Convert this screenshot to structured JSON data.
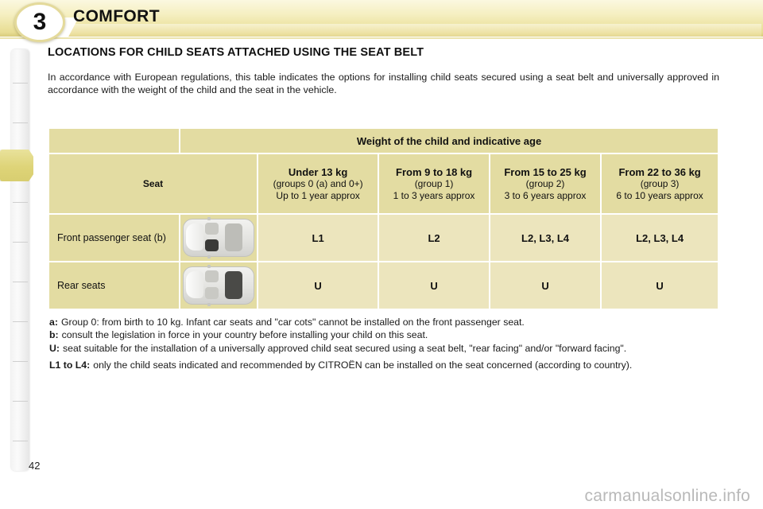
{
  "header": {
    "chapter_number": "3",
    "chapter_title": "COMFORT",
    "accent_color": "#e3dca2",
    "banner_color": "#efe8b4"
  },
  "section": {
    "title": "LOCATIONS FOR CHILD SEATS ATTACHED USING THE SEAT BELT",
    "intro": "In accordance with European regulations, this table indicates the options for installing child seats secured using a seat belt and universally approved in accordance with the weight of the child and the seat in the vehicle."
  },
  "table": {
    "band_title": "Weight of the child and indicative age",
    "seat_column_header": "Seat",
    "columns": [
      {
        "weight": "Under 13 kg",
        "group": "(groups 0 (a) and 0+)",
        "age": "Up to 1 year approx"
      },
      {
        "weight": "From 9 to 18 kg",
        "group": "(group 1)",
        "age": "1 to 3 years approx"
      },
      {
        "weight": "From 15 to 25 kg",
        "group": "(group 2)",
        "age": "3 to 6 years approx"
      },
      {
        "weight": "From 22 to 36 kg",
        "group": "(group 3)",
        "age": "6 to 10 years approx"
      }
    ],
    "rows": [
      {
        "label": "Front passenger seat (b)",
        "icon": "car-top-view-front-passenger-highlighted",
        "values": [
          "L1",
          "L2",
          "L2, L3, L4",
          "L2, L3, L4"
        ]
      },
      {
        "label": "Rear seats",
        "icon": "car-top-view-rear-bench-highlighted",
        "values": [
          "U",
          "U",
          "U",
          "U"
        ]
      }
    ]
  },
  "notes": [
    {
      "key": "a:",
      "text": "Group 0: from birth to 10 kg. Infant car seats and \"car cots\" cannot be installed on the front passenger seat."
    },
    {
      "key": "b:",
      "text": "consult the legislation in force in your country before installing your child on this seat."
    },
    {
      "key": "U:",
      "text": "seat suitable for the installation of a universally approved child seat secured using a seat belt, \"rear facing\" and/or \"forward facing\"."
    },
    {
      "key": "L1 to L4:",
      "text": "only the child seats indicated and recommended by CITROËN can be installed on the seat concerned (according to country)."
    }
  ],
  "footer": {
    "page_number": "42",
    "watermark": "carmanualsonline.info"
  }
}
